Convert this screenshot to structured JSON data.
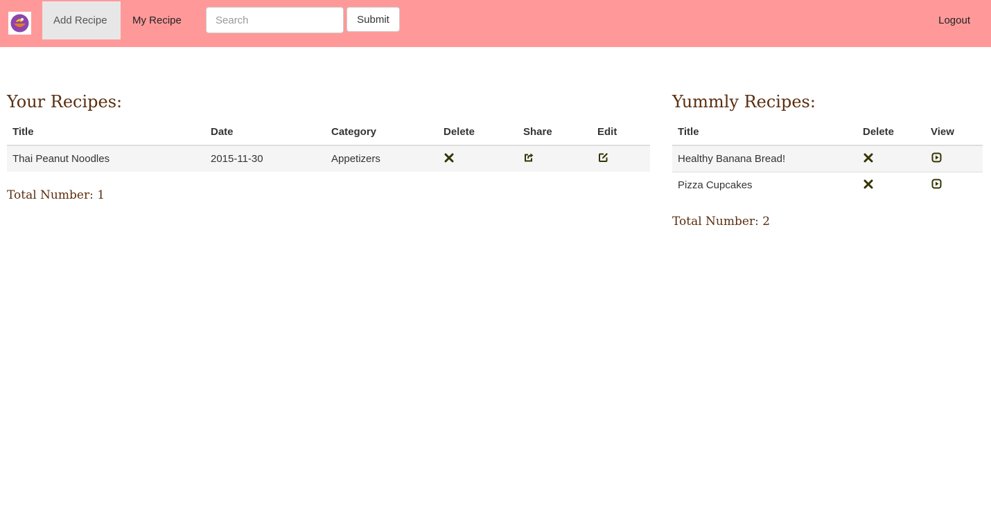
{
  "nav": {
    "logo_icon": "recipe-bowl-logo-icon",
    "add_recipe": "Add Recipe",
    "my_recipe": "My Recipe",
    "search_placeholder": "Search",
    "submit": "Submit",
    "logout": "Logout",
    "bar_color": "#ff9999"
  },
  "your_recipes": {
    "title": "Your Recipes:",
    "columns": [
      "Title",
      "Date",
      "Category",
      "Delete",
      "Share",
      "Edit"
    ],
    "rows": [
      {
        "title": "Thai Peanut Noodles",
        "date": "2015-11-30",
        "category": "Appetizers",
        "delete_icon": "close-icon",
        "share_icon": "share-icon",
        "edit_icon": "edit-icon"
      }
    ],
    "total": "Total Number: 1"
  },
  "yummly_recipes": {
    "title": "Yummly Recipes:",
    "columns": [
      "Title",
      "Delete",
      "View"
    ],
    "rows": [
      {
        "title": "Healthy Banana Bread!",
        "delete_icon": "close-icon",
        "view_icon": "play-icon"
      },
      {
        "title": "Pizza Cupcakes",
        "delete_icon": "close-icon",
        "view_icon": "play-icon"
      }
    ],
    "total": "Total Number: 2"
  },
  "colors": {
    "heading": "#5a2e0e",
    "icon": "#333300"
  }
}
